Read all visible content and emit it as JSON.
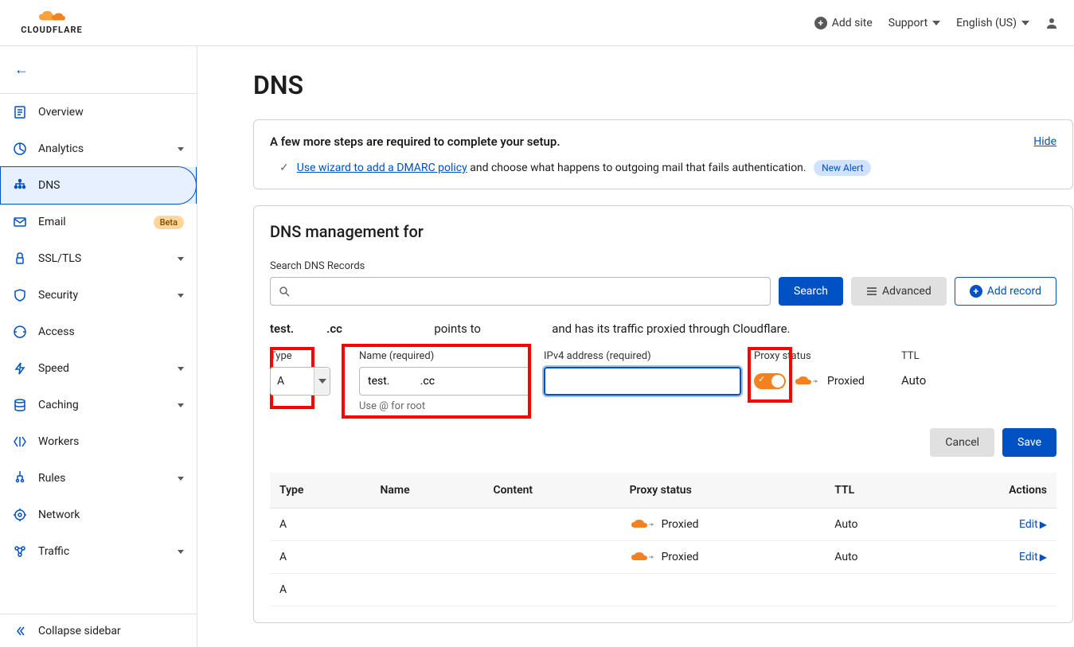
{
  "header": {
    "brand": "CLOUDFLARE",
    "add_site": "Add site",
    "support": "Support",
    "language": "English (US)"
  },
  "sidebar": {
    "items": [
      {
        "label": "Overview",
        "expandable": false,
        "active": false
      },
      {
        "label": "Analytics",
        "expandable": true,
        "active": false
      },
      {
        "label": "DNS",
        "expandable": false,
        "active": true
      },
      {
        "label": "Email",
        "expandable": false,
        "active": false,
        "badge": "Beta"
      },
      {
        "label": "SSL/TLS",
        "expandable": true,
        "active": false
      },
      {
        "label": "Security",
        "expandable": true,
        "active": false
      },
      {
        "label": "Access",
        "expandable": false,
        "active": false
      },
      {
        "label": "Speed",
        "expandable": true,
        "active": false
      },
      {
        "label": "Caching",
        "expandable": true,
        "active": false
      },
      {
        "label": "Workers",
        "expandable": false,
        "active": false
      },
      {
        "label": "Rules",
        "expandable": true,
        "active": false
      },
      {
        "label": "Network",
        "expandable": false,
        "active": false
      },
      {
        "label": "Traffic",
        "expandable": true,
        "active": false
      }
    ],
    "collapse": "Collapse sidebar"
  },
  "page": {
    "title": "DNS",
    "setup": {
      "title": "A few more steps are required to complete your setup.",
      "hide": "Hide",
      "wizard_link": "Use wizard to add a DMARC policy",
      "wizard_rest": " and choose what happens to outgoing mail that fails authentication.",
      "badge": "New Alert"
    },
    "mgmt_title": "DNS management for",
    "search_label": "Search DNS Records",
    "search_btn": "Search",
    "advanced_btn": "Advanced",
    "add_btn": "Add record",
    "sentence": {
      "p1": "test.",
      "p2": ".cc",
      "p3": "points to",
      "p4": "and has its traffic proxied through Cloudflare."
    },
    "form": {
      "type_label": "Type",
      "type_value": "A",
      "name_label": "Name (required)",
      "name_value": "test.           .cc",
      "name_hint": "Use @ for root",
      "ip_label": "IPv4 address (required)",
      "ip_value": "",
      "proxy_label": "Proxy status",
      "proxy_value": "Proxied",
      "ttl_label": "TTL",
      "ttl_value": "Auto"
    },
    "cancel": "Cancel",
    "save": "Save",
    "table": {
      "headers": [
        "Type",
        "Name",
        "Content",
        "Proxy status",
        "TTL",
        "Actions"
      ],
      "rows": [
        {
          "type": "A",
          "name": "",
          "content": "",
          "proxy": "Proxied",
          "ttl": "Auto",
          "action": "Edit"
        },
        {
          "type": "A",
          "name": "",
          "content": "",
          "proxy": "Proxied",
          "ttl": "Auto",
          "action": "Edit"
        },
        {
          "type": "A",
          "name": "",
          "content": "",
          "proxy": "",
          "ttl": "",
          "action": ""
        }
      ]
    }
  }
}
